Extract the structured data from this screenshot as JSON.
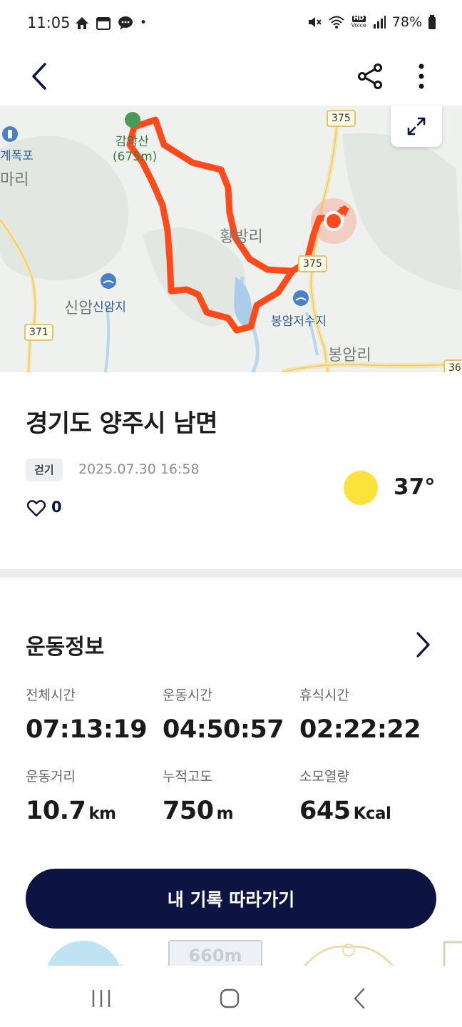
{
  "status_bar": {
    "time": "11:05",
    "battery": "78%",
    "hd_label": "HD",
    "voice_label": "Voice",
    "dot": "•"
  },
  "header": {
    "back_label": "back",
    "share_label": "share",
    "more_label": "more"
  },
  "map": {
    "labels": {
      "gyepo": "계폭포",
      "mari": "마리",
      "mountain": "감악산",
      "mountain_alt": "(675m)",
      "hwangbang": "황방리",
      "sinam_village": "신암",
      "sinam_reservoir": "신암지",
      "bongam_reservoir": "봉암저수지",
      "bongam_village": "봉암리"
    },
    "roads": [
      "375",
      "375",
      "371",
      "36"
    ]
  },
  "activity": {
    "location": "경기도 양주시 남면",
    "type": "걷기",
    "datetime": "2025.07.30 16:58",
    "likes": "0",
    "temperature": "37°"
  },
  "section": {
    "title": "운동정보"
  },
  "stats": [
    {
      "label": "전체시간",
      "value": "07:13:19",
      "unit": ""
    },
    {
      "label": "운동시간",
      "value": "04:50:57",
      "unit": ""
    },
    {
      "label": "휴식시간",
      "value": "02:22:22",
      "unit": ""
    },
    {
      "label": "운동거리",
      "value": "10.7",
      "unit": "km"
    },
    {
      "label": "누적고도",
      "value": "750",
      "unit": "m"
    },
    {
      "label": "소모열량",
      "value": "645",
      "unit": "Kcal"
    }
  ],
  "follow_button": "내 기록 따라가기",
  "thumbnails": {
    "altitude_text": "660m"
  },
  "colors": {
    "navy": "#0d1442",
    "route": "#ff4a1c",
    "weather_sun": "#fce23b"
  }
}
